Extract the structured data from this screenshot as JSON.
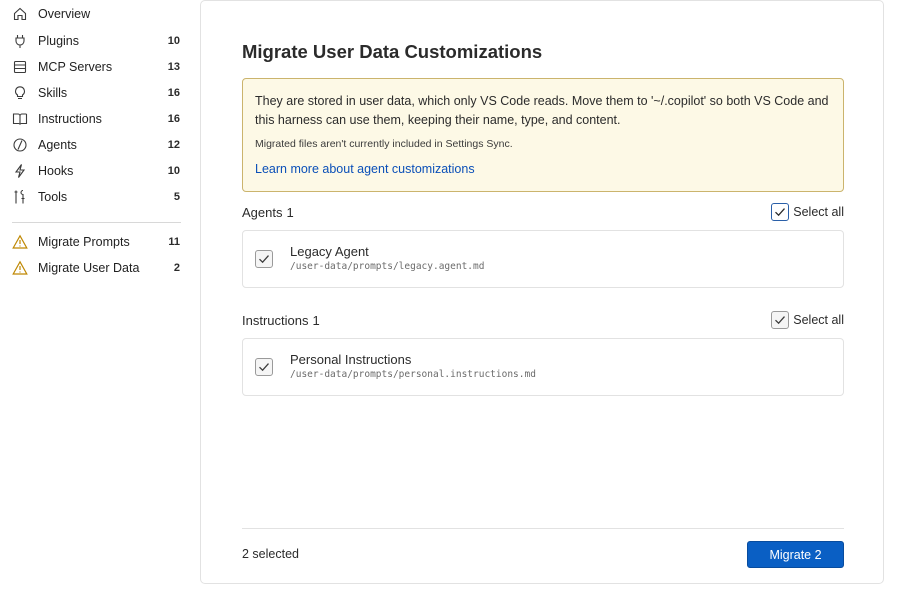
{
  "sidebar": {
    "items": [
      {
        "label": "Overview",
        "count": "",
        "icon": "home-icon"
      },
      {
        "label": "Plugins",
        "count": "10",
        "icon": "plug-icon"
      },
      {
        "label": "MCP Servers",
        "count": "13",
        "icon": "server-icon"
      },
      {
        "label": "Skills",
        "count": "16",
        "icon": "lightbulb-icon"
      },
      {
        "label": "Instructions",
        "count": "16",
        "icon": "book-icon"
      },
      {
        "label": "Agents",
        "count": "12",
        "icon": "agent-icon"
      },
      {
        "label": "Hooks",
        "count": "10",
        "icon": "lightning-icon"
      },
      {
        "label": "Tools",
        "count": "5",
        "icon": "tools-icon"
      }
    ],
    "migrate_items": [
      {
        "label": "Migrate Prompts",
        "count": "11",
        "icon": "warning-icon"
      },
      {
        "label": "Migrate User Data",
        "count": "2",
        "icon": "warning-icon"
      }
    ]
  },
  "main": {
    "title": "Migrate User Data Customizations",
    "notice": {
      "text": "They are stored in user data, which only VS Code reads. Move them to '~/.copilot' so both VS Code and this harness can use them, keeping their name, type, and content.",
      "subtext": "Migrated files aren't currently included in Settings Sync.",
      "link": "Learn more about agent customizations"
    },
    "sections": [
      {
        "title": "Agents",
        "count": "1",
        "select_all_label": "Select all",
        "select_all_checked": true,
        "items": [
          {
            "name": "Legacy Agent",
            "path": "/user-data/prompts/legacy.agent.md",
            "checked": true
          }
        ]
      },
      {
        "title": "Instructions",
        "count": "1",
        "select_all_label": "Select all",
        "select_all_checked": true,
        "items": [
          {
            "name": "Personal Instructions",
            "path": "/user-data/prompts/personal.instructions.md",
            "checked": true
          }
        ]
      }
    ],
    "footer": {
      "status": "2 selected",
      "button_label": "Migrate 2"
    }
  },
  "colors": {
    "accent": "#0a5fc4",
    "link": "#0b50b8",
    "warning": "#bf8803",
    "notice_bg": "#fdf9e6",
    "notice_border": "#cbb46d"
  }
}
